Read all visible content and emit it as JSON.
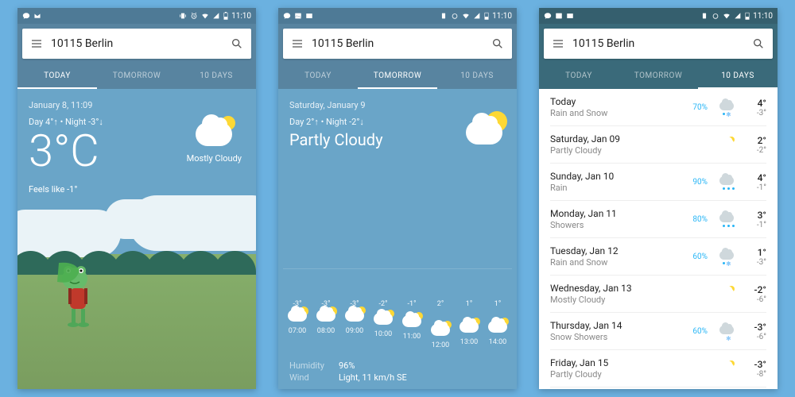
{
  "statusbar": {
    "time": "11:10"
  },
  "search": {
    "location": "10115 Berlin"
  },
  "tabs": {
    "today": "TODAY",
    "tomorrow": "TOMORROW",
    "tendays": "10 DAYS"
  },
  "today": {
    "datetime": "January 8, 11:09",
    "daynight": "Day 4°↑ • Night -3°↓",
    "temp": "3°C",
    "feels": "Feels like -1°",
    "condition": "Mostly Cloudy"
  },
  "tomorrow": {
    "date": "Saturday, January 9",
    "daynight": "Day 2°↑ • Night -2°↓",
    "condition": "Partly Cloudy",
    "humidity_k": "Humidity",
    "humidity_v": "96%",
    "wind_k": "Wind",
    "wind_v": "Light, 11 km/h SE",
    "hours": [
      {
        "time": "07:00",
        "temp": "-3°",
        "icon": "moon-cloud"
      },
      {
        "time": "08:00",
        "temp": "-3°",
        "icon": "moon-cloud"
      },
      {
        "time": "09:00",
        "temp": "-3°",
        "icon": "sun-cloud"
      },
      {
        "time": "10:00",
        "temp": "-2°",
        "icon": "sun-cloud"
      },
      {
        "time": "11:00",
        "temp": "-1°",
        "icon": "sun-cloud"
      },
      {
        "time": "12:00",
        "temp": "2°",
        "icon": "sun-cloud"
      },
      {
        "time": "13:00",
        "temp": "1°",
        "icon": "sun-cloud"
      },
      {
        "time": "14:00",
        "temp": "1°",
        "icon": "sun-cloud"
      }
    ]
  },
  "forecast": [
    {
      "name": "Today",
      "cond": "Rain and Snow",
      "precip": "70%",
      "icon": "rain-snow",
      "hi": "4°",
      "lo": "-3°"
    },
    {
      "name": "Saturday, Jan 09",
      "cond": "Partly Cloudy",
      "precip": "",
      "icon": "sun-cloud",
      "hi": "2°",
      "lo": "-2°"
    },
    {
      "name": "Sunday, Jan 10",
      "cond": "Rain",
      "precip": "90%",
      "icon": "rain",
      "hi": "4°",
      "lo": "-1°"
    },
    {
      "name": "Monday, Jan 11",
      "cond": "Showers",
      "precip": "80%",
      "icon": "rain",
      "hi": "3°",
      "lo": "-1°"
    },
    {
      "name": "Tuesday, Jan 12",
      "cond": "Rain and Snow",
      "precip": "60%",
      "icon": "rain-snow",
      "hi": "1°",
      "lo": "-3°"
    },
    {
      "name": "Wednesday, Jan 13",
      "cond": "Mostly Cloudy",
      "precip": "",
      "icon": "sun-cloud",
      "hi": "-2°",
      "lo": "-6°"
    },
    {
      "name": "Thursday, Jan 14",
      "cond": "Snow Showers",
      "precip": "60%",
      "icon": "snow",
      "hi": "-3°",
      "lo": "-6°"
    },
    {
      "name": "Friday, Jan 15",
      "cond": "Partly Cloudy",
      "precip": "",
      "icon": "sun-cloud",
      "hi": "-3°",
      "lo": "-8°"
    }
  ]
}
